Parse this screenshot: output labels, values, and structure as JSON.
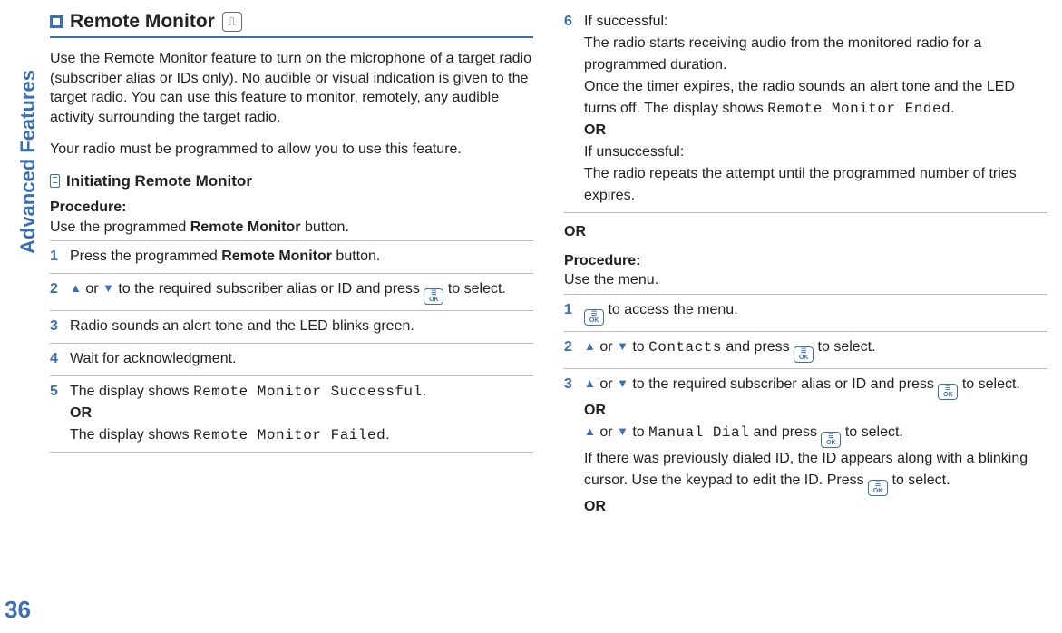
{
  "sidebar": {
    "label": "Advanced Features",
    "page_number": "36"
  },
  "left": {
    "h1": "Remote Monitor",
    "h1_icon_glyph": "⎍",
    "para1": "Use the Remote Monitor feature to turn on the microphone of a target radio (subscriber alias or IDs only). No audible or visual indication is given to the target radio. You can use this feature to monitor, remotely, any audible activity surrounding the target radio.",
    "para2": "Your radio must be programmed to allow you to use this feature.",
    "h2": "Initiating Remote Monitor",
    "proc_label": "Procedure:",
    "proc_line": "Use the programmed ",
    "proc_btn": "Remote Monitor",
    "proc_line_end": " button.",
    "steps": {
      "s1": {
        "n": "1",
        "a": "Press the programmed ",
        "b": "Remote Monitor",
        "c": " button."
      },
      "s2": {
        "n": "2",
        "mid": " to the required subscriber alias or ID and press ",
        "end": " to select."
      },
      "s3": {
        "n": "3",
        "text": "Radio sounds an alert tone and the LED blinks green."
      },
      "s4": {
        "n": "4",
        "text": "Wait for acknowledgment."
      },
      "s5": {
        "n": "5",
        "a": "The display shows ",
        "m1": "Remote Monitor Successful",
        "dot": ".",
        "or": "OR",
        "b": "The display shows ",
        "m2": "Remote Monitor Failed"
      }
    }
  },
  "right": {
    "s6": {
      "n": "6",
      "ok": "If successful:",
      "l1": "The radio starts receiving audio from the monitored radio for a programmed duration.",
      "l2a": "Once the timer expires, the radio sounds an alert tone and the LED turns off. The display shows ",
      "l2m": "Remote Monitor Ended",
      "dot": ".",
      "or": "OR",
      "fail": "If unsuccessful:",
      "l3": "The radio repeats the attempt until the programmed number of tries expires."
    },
    "or_outer": "OR",
    "proc_label": "Procedure:",
    "proc_line": "Use the menu.",
    "steps": {
      "s1": {
        "n": "1",
        "text": " to access the menu."
      },
      "s2": {
        "n": "2",
        "a": " to ",
        "m": "Contacts",
        "b": " and press ",
        "c": " to select."
      },
      "s3": {
        "n": "3",
        "a": " to the required subscriber alias or ID and press ",
        "b": " to select.",
        "or1": "OR",
        "c": " to ",
        "m1": "Manual Dial",
        "d": " and press ",
        "e": " to select.",
        "f": "If there was previously dialed ID, the ID appears along with a blinking cursor. Use the keypad to edit the ID. Press ",
        "g": " to select.",
        "or2": "OR"
      }
    }
  },
  "glyph": {
    "or_word": " or ",
    "ok": "▭\nOK"
  }
}
